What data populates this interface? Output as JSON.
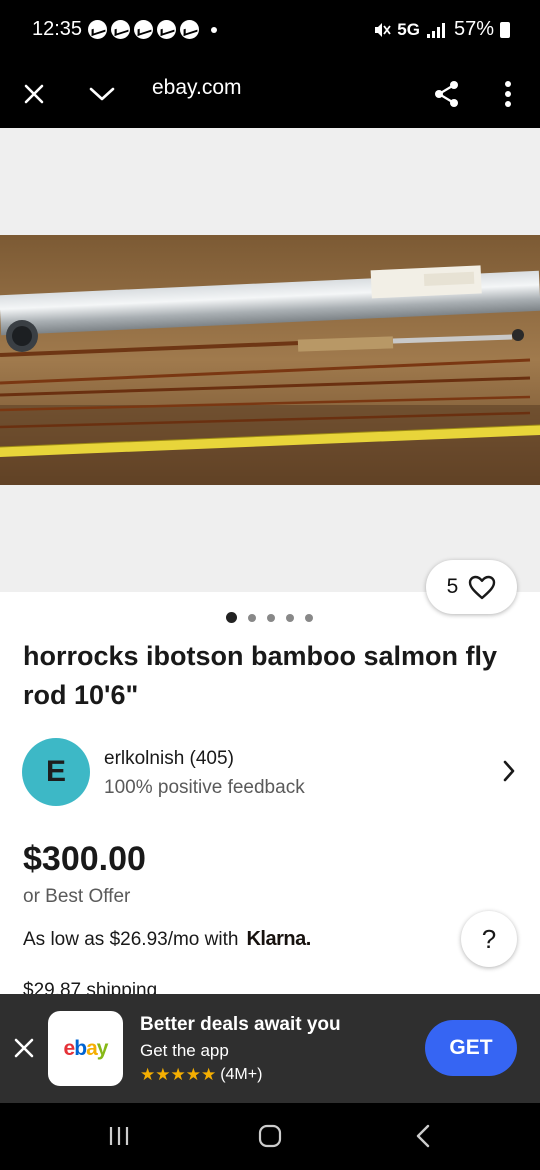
{
  "status_bar": {
    "time": "12:35",
    "network": "5G",
    "battery": "57%",
    "notification_icons": [
      "messenger-icon",
      "messenger-icon",
      "messenger-icon",
      "messenger-icon",
      "messenger-icon"
    ]
  },
  "browser": {
    "url": "ebay.com"
  },
  "listing": {
    "image_count": 5,
    "active_image_index": 0,
    "favorite_count": "5",
    "title": "horrocks ibotson bamboo salmon fly rod 10'6\"",
    "seller": {
      "avatar_letter": "E",
      "name": "erlkolnish (405)",
      "feedback": "100% positive feedback"
    },
    "price": "$300.00",
    "best_offer": "or Best Offer",
    "financing_text": "As low as $26.93/mo with",
    "financing_provider": "Klarna.",
    "help_label": "?",
    "shipping": "$29.87 shipping"
  },
  "app_banner": {
    "logo_letters": [
      "e",
      "b",
      "a",
      "y"
    ],
    "logo_colors": [
      "#e53238",
      "#0064d2",
      "#f5af02",
      "#86b817"
    ],
    "title": "Better deals await you",
    "subtitle": "Get the app",
    "stars": "★★★★★",
    "rating_count": "(4M+)",
    "get_label": "GET"
  },
  "colors": {
    "accent_blue": "#3665f3",
    "avatar_teal": "#3db8c6",
    "star_gold": "#f5af02"
  }
}
